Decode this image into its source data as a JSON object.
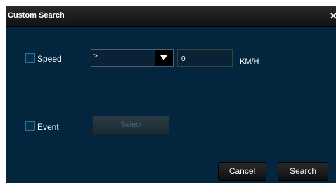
{
  "dialog": {
    "title": "Custom Search",
    "close_glyph": "✕",
    "close_icon": "close-icon"
  },
  "speed": {
    "label": "Speed",
    "checked": false,
    "operator_value": ">",
    "value": "0",
    "unit": "KM/H",
    "dropdown_icon": "chevron-down-icon"
  },
  "event": {
    "label": "Event",
    "checked": false,
    "select_button_label": "Select"
  },
  "footer": {
    "cancel_label": "Cancel",
    "search_label": "Search"
  },
  "colors": {
    "dialog_background": "#03263e",
    "titlebar_background": "#1a1a1a",
    "text": "#ffffff",
    "disabled_text": "#516673"
  }
}
